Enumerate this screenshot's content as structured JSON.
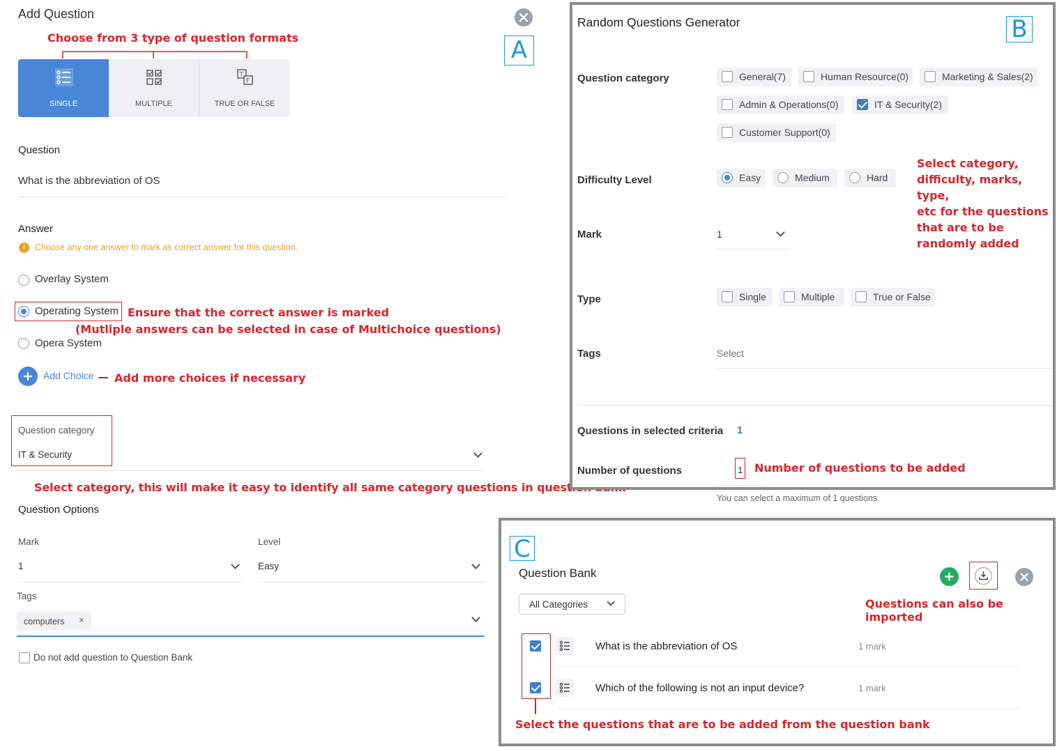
{
  "add_question": {
    "title": "Add Question",
    "format_tabs": [
      {
        "label": "SINGLE",
        "active": true
      },
      {
        "label": "MULTIPLE",
        "active": false
      },
      {
        "label": "TRUE OR FALSE",
        "active": false
      }
    ],
    "question_label": "Question",
    "question_value": "What is the abbreviation of OS",
    "answer_label": "Answer",
    "answer_hint": "Choose any one answer to mark as correct answer for this question.",
    "choices": [
      {
        "label": "Overlay System",
        "selected": false
      },
      {
        "label": "Operating System",
        "selected": true
      },
      {
        "label": "Opera System",
        "selected": false
      }
    ],
    "add_choice": "Add Choice",
    "category_label": "Question category",
    "category_value": "IT & Security",
    "options_label": "Question Options",
    "mark_label": "Mark",
    "mark_value": "1",
    "level_label": "Level",
    "level_value": "Easy",
    "tags_label": "Tags",
    "tag_chip": "computers",
    "chip_remove": "×",
    "no_bank_label": "Do not add question to Question Bank"
  },
  "random_generator": {
    "title": "Random Questions Generator",
    "category_label": "Question category",
    "categories": [
      {
        "label": "General(7)",
        "checked": false
      },
      {
        "label": "Human Resource(0)",
        "checked": false
      },
      {
        "label": "Marketing & Sales(2)",
        "checked": false
      },
      {
        "label": "Admin & Operations(0)",
        "checked": false
      },
      {
        "label": "IT & Security(2)",
        "checked": true
      },
      {
        "label": "Customer Support(0)",
        "checked": false
      }
    ],
    "difficulty_label": "Difficulty Level",
    "difficulties": [
      {
        "label": "Easy",
        "selected": true
      },
      {
        "label": "Medium",
        "selected": false
      },
      {
        "label": "Hard",
        "selected": false
      }
    ],
    "mark_label": "Mark",
    "mark_value": "1",
    "type_label": "Type",
    "types": [
      {
        "label": "Single",
        "checked": false
      },
      {
        "label": "Multiple",
        "checked": false
      },
      {
        "label": "True or False",
        "checked": false
      }
    ],
    "tags_label": "Tags",
    "tags_placeholder": "Select",
    "criteria_label": "Questions in selected criteria",
    "criteria_value": "1",
    "number_label": "Number of questions",
    "number_value": "1",
    "max_note": "You can select a maximum of 1 questions."
  },
  "question_bank": {
    "title": "Question Bank",
    "filter_value": "All Categories",
    "rows": [
      {
        "text": "What is the abbreviation of OS",
        "marks": "1 mark",
        "checked": true
      },
      {
        "text": "Which of the following is not an input device?",
        "marks": "1 mark",
        "checked": true
      }
    ]
  },
  "annotations": {
    "letter_a": "A",
    "letter_b": "B",
    "letter_c": "C",
    "formats": "Choose from 3 type of question formats",
    "correct_1": "Ensure that the correct answer is marked",
    "correct_2": "(Mutliple answers can be selected in case of Multichoice questions)",
    "add_more": "Add more choices if necessary",
    "category": "Select category, this will make it easy to identify all same category questions in question bank",
    "random": [
      "Select category,",
      "difficulty, marks, type,",
      "etc for the questions",
      "that are to be",
      "randomly added"
    ],
    "number": "Number of questions to be added",
    "import": "Questions can also be imported",
    "bank_select": "Select the questions that are to be added from the question bank"
  },
  "colors": {
    "annotation": "#d9252c",
    "accent_blue": "#4a86d8",
    "letter_blue": "#1a9ad6",
    "add_green": "#1fae5b",
    "hint_orange": "#f0a020"
  }
}
